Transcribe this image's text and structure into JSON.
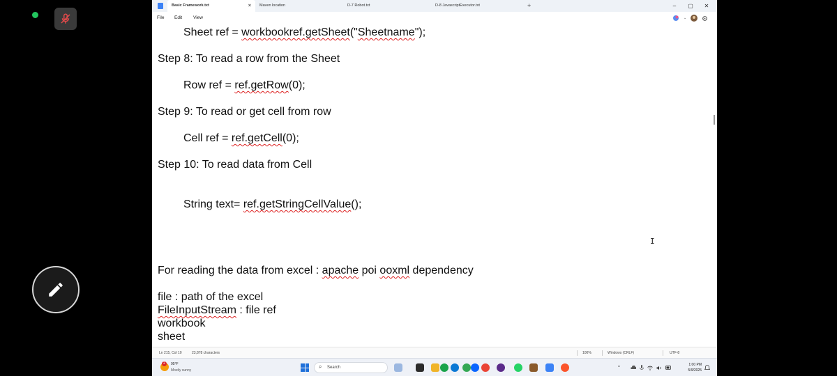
{
  "window": {
    "tabs": [
      {
        "label": "Basic Framework.txt",
        "active": true,
        "close": "×"
      },
      {
        "label": "Maven location",
        "active": false,
        "close": ""
      },
      {
        "label": "D-7 Robot.txt",
        "active": false,
        "close": "•"
      },
      {
        "label": "D-8 JavascriptExecutor.txt",
        "active": false,
        "close": ""
      }
    ],
    "new_tab": "+",
    "controls": {
      "minimize": "–",
      "maximize": "▢",
      "close": "✕"
    }
  },
  "menu": {
    "file": "File",
    "edit": "Edit",
    "view": "View"
  },
  "document": {
    "line1_prefix": "Sheet ref = ",
    "line1_sq": "workbookref.getSheet",
    "line1_mid": "(\"",
    "line1_sq2": "Sheetname",
    "line1_suffix": "\");",
    "step8": "Step  8: To read a row from the Sheet",
    "line_row_prefix": "Row ref = ",
    "line_row_sq": "ref.getRow",
    "line_row_suffix": "(0);",
    "step9": "Step 9: To read or get cell from row",
    "line_cell_prefix": "Cell ref = ",
    "line_cell_sq": "ref.getCell",
    "line_cell_suffix": "(0);",
    "step10": "Step 10: To read data from Cell",
    "line_string_prefix": "String text= ",
    "line_string_sq": "ref.getStringCellValue",
    "line_string_suffix": "();",
    "reading_prefix": "For reading the data from excel : ",
    "reading_sq1": "apache",
    "reading_mid1": " poi ",
    "reading_sq2": "ooxml",
    "reading_suffix": " dependency",
    "file_line": "file : path of the excel",
    "fis_sq": "FileInputStream",
    "fis_suffix": " : file ref",
    "workbook": "workbook",
    "sheet": "sheet"
  },
  "status": {
    "position": "Ln 215, Col 10",
    "characters": "23,878 characters",
    "zoom": "100%",
    "line_ending": "Windows (CRLF)",
    "encoding": "UTF-8"
  },
  "taskbar": {
    "weather_badge": "2",
    "temperature": "95°F",
    "condition": "Mostly sunny",
    "search_label": "Search",
    "time": "1:00 PM",
    "date": "5/9/2025",
    "tray_chevron": "^"
  },
  "colors": {
    "accent": "#1e6fd9",
    "spell_error": "#dd2222",
    "online": "#22c55e"
  }
}
